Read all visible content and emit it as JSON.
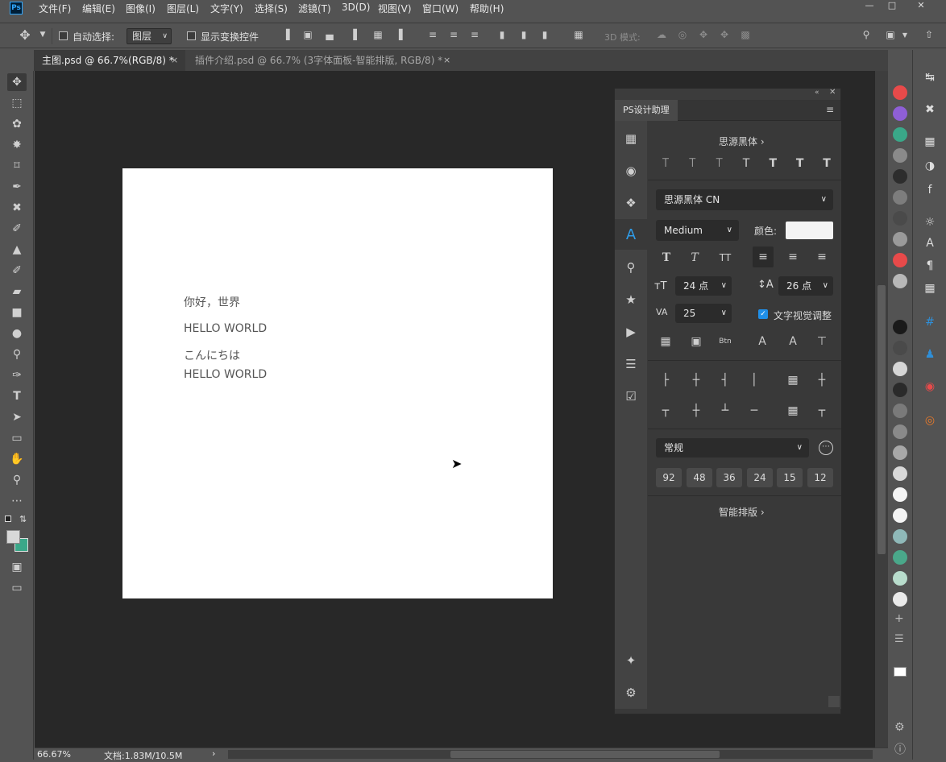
{
  "app_logo": "Ps",
  "menu": [
    "文件(F)",
    "编辑(E)",
    "图像(I)",
    "图层(L)",
    "文字(Y)",
    "选择(S)",
    "滤镜(T)",
    "3D(D)",
    "视图(V)",
    "窗口(W)",
    "帮助(H)"
  ],
  "options": {
    "auto_select_label": "自动选择:",
    "auto_select_value": "图层",
    "show_transform_label": "显示变换控件",
    "mode_3d_label": "3D 模式:"
  },
  "tabs": [
    {
      "label": "主图.psd @ 66.7%(RGB/8) *",
      "close": "×"
    },
    {
      "label": "插件介绍.psd @ 66.7% (3字体面板-智能排版, RGB/8) *",
      "close": "×"
    }
  ],
  "canvas": {
    "lines": [
      "你好，世界",
      "HELLO WORLD",
      "こんにちは",
      "HELLO WORLD"
    ]
  },
  "status": {
    "zoom": "66.67%",
    "doc": "文档:1.83M/10.5M"
  },
  "panel": {
    "tab_label": "PS设计助理",
    "font_header": "思源黑体",
    "font_family": "思源黑体 CN",
    "font_weight": "Medium",
    "color_label": "颜色:",
    "font_size": "24 点",
    "leading": "26 点",
    "tracking": "25",
    "visual_adjust_label": "文字视觉调整",
    "style_select": "常规",
    "sizes": [
      "92",
      "48",
      "36",
      "24",
      "15",
      "12"
    ],
    "smart_layout": "智能排版"
  },
  "swatch_colors": [
    "#e84a4a",
    "#8e5fd6",
    "#3aa889",
    "#8a8a8a",
    "#2d2d2d",
    "#7d7d7d",
    "#4a4a4a",
    "#9a9a9a",
    "#e84a4a",
    "#b8b8b8",
    "#1a1a1a",
    "#4a4a4a",
    "#d6d6d6",
    "#2a2a2a",
    "#7a7a7a",
    "#8a8a8a",
    "#a8a8a8",
    "#d8d8d8",
    "#f4f4f4",
    "#f4f4f4",
    "#8fb8b8",
    "#4aa88a",
    "#b8dccc",
    "#eaeaea"
  ]
}
